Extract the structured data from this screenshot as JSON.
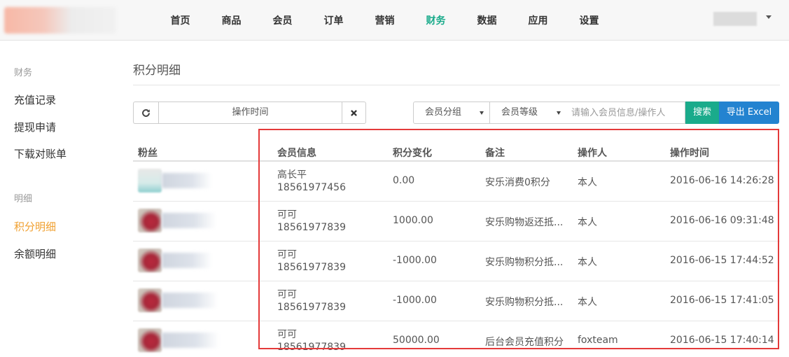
{
  "nav": {
    "items": [
      "首页",
      "商品",
      "会员",
      "订单",
      "营销",
      "财务",
      "数据",
      "应用",
      "设置"
    ],
    "active_index": 5
  },
  "sidebar": {
    "sections": [
      {
        "title": "财务",
        "items": [
          "充值记录",
          "提现申请",
          "下载对账单"
        ]
      },
      {
        "title": "明细",
        "items": [
          "积分明细",
          "余额明细"
        ]
      }
    ],
    "active_item": "积分明细"
  },
  "page": {
    "title": "积分明细"
  },
  "filters": {
    "date_label": "操作时间",
    "member_group": "会员分组",
    "member_level": "会员等级",
    "search_placeholder": "请输入会员信息/操作人",
    "search_button": "搜索",
    "export_button": "导出 Excel"
  },
  "table": {
    "columns": [
      "粉丝",
      "会员信息",
      "积分变化",
      "备注",
      "操作人",
      "操作时间"
    ],
    "rows": [
      {
        "name": "高长平",
        "phone": "18561977456",
        "change": "0.00",
        "remark": "安乐消费0积分",
        "operator": "本人",
        "time": "2016-06-16 14:26:28"
      },
      {
        "name": "可可",
        "phone": "18561977839",
        "change": "1000.00",
        "remark": "安乐购物返还抵...",
        "operator": "本人",
        "time": "2016-06-16 09:31:48"
      },
      {
        "name": "可可",
        "phone": "18561977839",
        "change": "-1000.00",
        "remark": "安乐购物积分抵...",
        "operator": "本人",
        "time": "2016-06-15 17:44:52"
      },
      {
        "name": "可可",
        "phone": "18561977839",
        "change": "-1000.00",
        "remark": "安乐购物积分抵...",
        "operator": "本人",
        "time": "2016-06-15 17:41:05"
      },
      {
        "name": "可可",
        "phone": "18561977839",
        "change": "50000.00",
        "remark": "后台会员充值积分",
        "operator": "foxteam",
        "time": "2016-06-15 17:40:14"
      }
    ]
  },
  "colors": {
    "accent_green": "#1aab8b",
    "export_blue": "#2383d0",
    "sidebar_active": "#f0a030",
    "highlight_red": "#e43a3a"
  }
}
